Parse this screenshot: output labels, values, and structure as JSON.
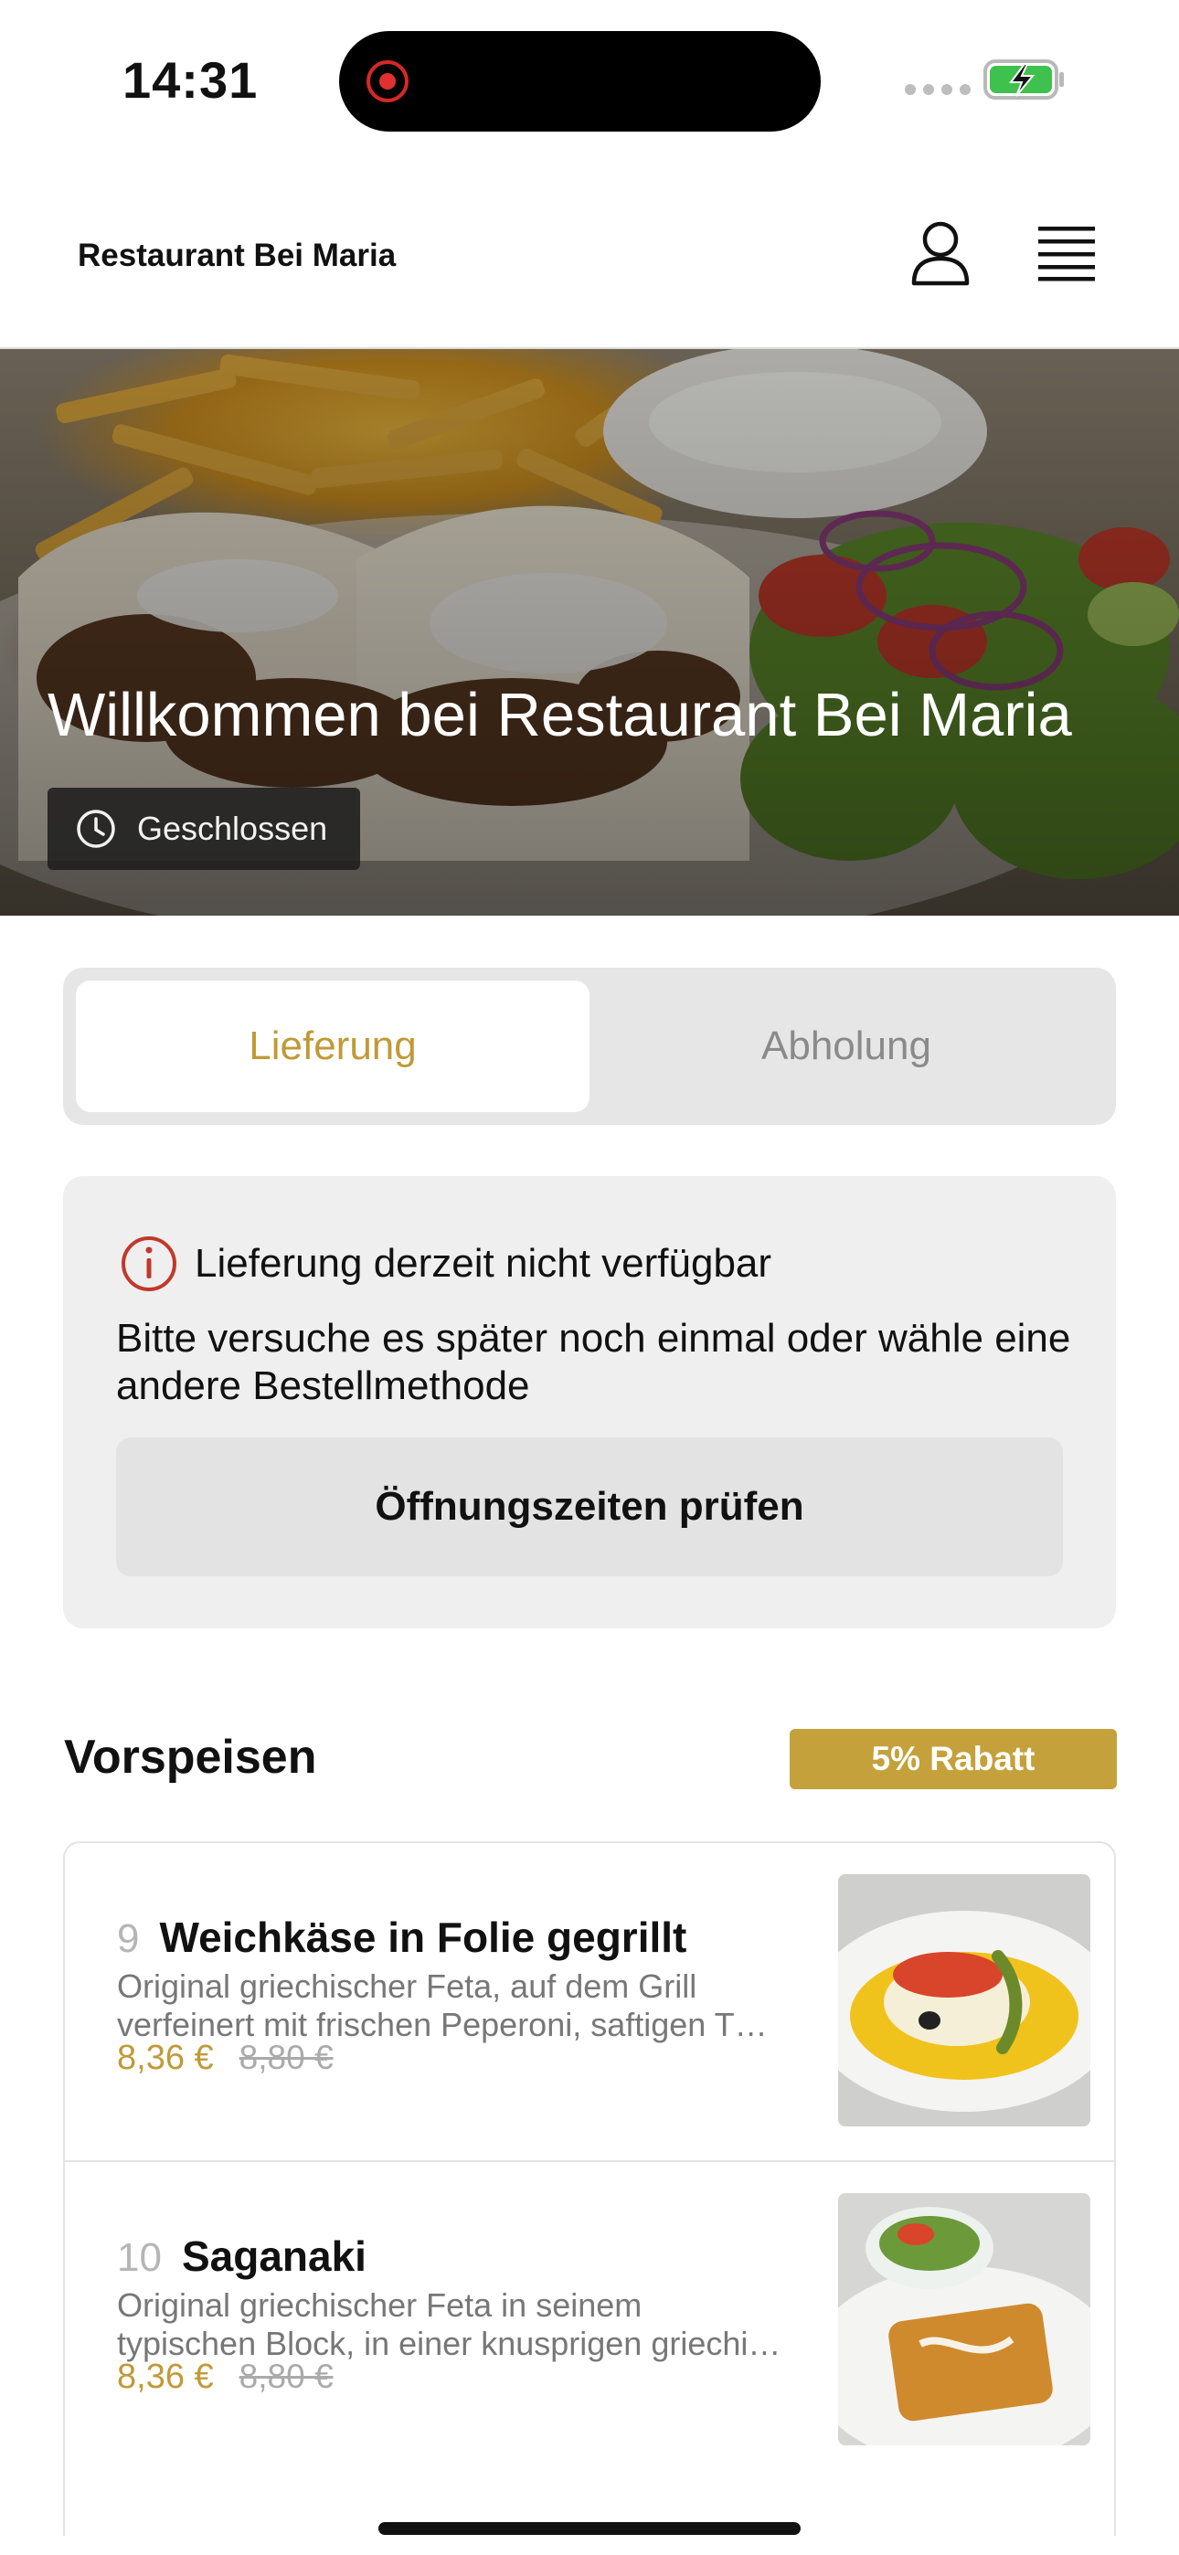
{
  "status_bar": {
    "time": "14:31"
  },
  "header": {
    "brand": "Restaurant Bei Maria"
  },
  "hero": {
    "title": "Willkommen bei Restaurant Bei Maria",
    "status": "Geschlossen"
  },
  "order_mode": {
    "options": [
      "Lieferung",
      "Abholung"
    ],
    "selected": "Lieferung"
  },
  "notice": {
    "title": "Lieferung derzeit nicht verfügbar",
    "body": "Bitte versuche es später noch einmal oder wähle eine andere Bestellmethode",
    "button_label": "Öffnungszeiten prüfen"
  },
  "section": {
    "title": "Vorspeisen",
    "badge": "5% Rabatt",
    "items": [
      {
        "number": "9",
        "name": "Weichkäse in Folie gegrillt",
        "description_line1": "Original griechischer Feta, auf dem Grill",
        "description_line2": "verfeinert mit frischen Peperoni, saftigen T…",
        "price": "8,36 €",
        "old_price": "8,80 €"
      },
      {
        "number": "10",
        "name": "Saganaki",
        "description_line1": "Original griechischer Feta in seinem",
        "description_line2": "typischen Block, in einer knusprigen griechi…",
        "price": "8,36 €",
        "old_price": "8,80 €"
      }
    ]
  },
  "colors": {
    "accent": "#c09a38",
    "badge": "#c4a13a",
    "alert": "#c0392b"
  }
}
